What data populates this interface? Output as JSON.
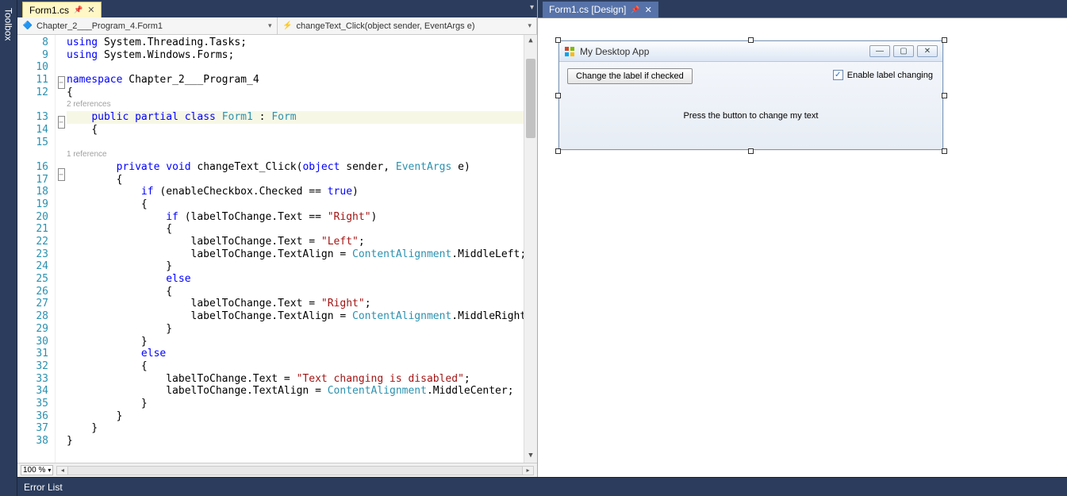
{
  "toolbox": {
    "label": "Toolbox"
  },
  "leftPane": {
    "tab": {
      "label": "Form1.cs"
    },
    "nav": {
      "combo1": "Chapter_2___Program_4.Form1",
      "combo2": "changeText_Click(object sender, EventArgs e)"
    },
    "lineStart": 8,
    "lines": [
      {
        "n": 8,
        "fold": "",
        "codelens": "",
        "html": "<span class='kw'>using</span> System.Threading.Tasks;"
      },
      {
        "n": 9,
        "fold": "",
        "codelens": "",
        "html": "<span class='kw'>using</span> System.Windows.Forms;"
      },
      {
        "n": 10,
        "fold": "",
        "codelens": "",
        "html": ""
      },
      {
        "n": 11,
        "fold": "box",
        "codelens": "",
        "html": "<span class='kw'>namespace</span> Chapter_2___Program_4"
      },
      {
        "n": 12,
        "fold": "",
        "codelens": "",
        "html": "{"
      },
      {
        "n": 0,
        "fold": "",
        "codelens": "2 references",
        "html": ""
      },
      {
        "n": 13,
        "fold": "box",
        "codelens": "",
        "hl": true,
        "html": "    <span class='kw'>public</span> <span class='kw'>partial</span> <span class='kw'>class</span> <span class='type'>Form1</span> : <span class='type'>Form</span>"
      },
      {
        "n": 14,
        "fold": "",
        "codelens": "",
        "html": "    {"
      },
      {
        "n": 15,
        "fold": "",
        "codelens": "",
        "html": ""
      },
      {
        "n": 0,
        "fold": "",
        "codelens": "1 reference",
        "html": ""
      },
      {
        "n": 16,
        "fold": "box",
        "codelens": "",
        "html": "        <span class='kw'>private</span> <span class='kw'>void</span> changeText_Click(<span class='kw'>object</span> sender, <span class='type'>EventArgs</span> e)"
      },
      {
        "n": 17,
        "fold": "",
        "codelens": "",
        "html": "        {"
      },
      {
        "n": 18,
        "fold": "",
        "codelens": "",
        "html": "            <span class='kw'>if</span> (enableCheckbox.Checked == <span class='kw'>true</span>)"
      },
      {
        "n": 19,
        "fold": "",
        "codelens": "",
        "html": "            {"
      },
      {
        "n": 20,
        "fold": "",
        "codelens": "",
        "html": "                <span class='kw'>if</span> (labelToChange.Text == <span class='str'>\"Right\"</span>)"
      },
      {
        "n": 21,
        "fold": "",
        "codelens": "",
        "html": "                {"
      },
      {
        "n": 22,
        "fold": "",
        "codelens": "",
        "html": "                    labelToChange.Text = <span class='str'>\"Left\"</span>;"
      },
      {
        "n": 23,
        "fold": "",
        "codelens": "",
        "html": "                    labelToChange.TextAlign = <span class='type'>ContentAlignment</span>.MiddleLeft;"
      },
      {
        "n": 24,
        "fold": "",
        "codelens": "",
        "html": "                }"
      },
      {
        "n": 25,
        "fold": "",
        "codelens": "",
        "html": "                <span class='kw'>else</span>"
      },
      {
        "n": 26,
        "fold": "",
        "codelens": "",
        "html": "                {"
      },
      {
        "n": 27,
        "fold": "",
        "codelens": "",
        "html": "                    labelToChange.Text = <span class='str'>\"Right\"</span>;"
      },
      {
        "n": 28,
        "fold": "",
        "codelens": "",
        "html": "                    labelToChange.TextAlign = <span class='type'>ContentAlignment</span>.MiddleRight;"
      },
      {
        "n": 29,
        "fold": "",
        "codelens": "",
        "html": "                }"
      },
      {
        "n": 30,
        "fold": "",
        "codelens": "",
        "html": "            }"
      },
      {
        "n": 31,
        "fold": "",
        "codelens": "",
        "html": "            <span class='kw'>else</span>"
      },
      {
        "n": 32,
        "fold": "",
        "codelens": "",
        "html": "            {"
      },
      {
        "n": 33,
        "fold": "",
        "codelens": "",
        "html": "                labelToChange.Text = <span class='str'>\"Text changing is disabled\"</span>;"
      },
      {
        "n": 34,
        "fold": "",
        "codelens": "",
        "html": "                labelToChange.TextAlign = <span class='type'>ContentAlignment</span>.MiddleCenter;"
      },
      {
        "n": 35,
        "fold": "",
        "codelens": "",
        "html": "            }"
      },
      {
        "n": 36,
        "fold": "",
        "codelens": "",
        "html": "        }"
      },
      {
        "n": 37,
        "fold": "",
        "codelens": "",
        "html": "    }"
      },
      {
        "n": 38,
        "fold": "",
        "codelens": "",
        "html": "}"
      }
    ],
    "zoom": "100 %"
  },
  "rightPane": {
    "tab": {
      "label": "Form1.cs [Design]"
    },
    "window": {
      "title": "My Desktop App",
      "button": "Change the label if checked",
      "checkbox": "Enable label changing",
      "label": "Press the button to change my text"
    }
  },
  "bottom": {
    "errorList": "Error List"
  }
}
